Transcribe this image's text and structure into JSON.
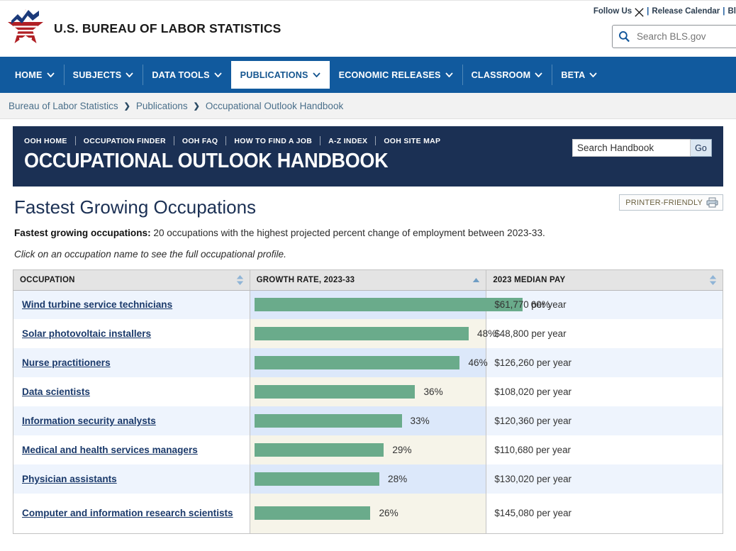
{
  "header": {
    "brand_name": "U.S. BUREAU OF LABOR STATISTICS",
    "follow_label": "Follow Us",
    "x_icon": "x-twitter-icon",
    "sep": "|",
    "release_calendar": "Release Calendar",
    "blog": "Bl",
    "search_placeholder": "Search BLS.gov",
    "search_value": "",
    "search_icon": "search-icon"
  },
  "mainnav": {
    "items": [
      {
        "label": "HOME",
        "active": false
      },
      {
        "label": "SUBJECTS",
        "active": false
      },
      {
        "label": "DATA TOOLS",
        "active": false
      },
      {
        "label": "PUBLICATIONS",
        "active": true
      },
      {
        "label": "ECONOMIC RELEASES",
        "active": false
      },
      {
        "label": "CLASSROOM",
        "active": false
      },
      {
        "label": "BETA",
        "active": false
      }
    ],
    "chevron_icon": "chevron-down-icon",
    "accent": "#115a9e",
    "active_text": "#14558f"
  },
  "breadcrumb": {
    "items": [
      "Bureau of Labor Statistics",
      "Publications",
      "Occupational Outlook Handbook"
    ],
    "separator_icon": "chevron-right-icon"
  },
  "ooh": {
    "subnav": [
      "OOH HOME",
      "OCCUPATION FINDER",
      "OOH FAQ",
      "HOW TO FIND A JOB",
      "A-Z INDEX",
      "OOH SITE MAP"
    ],
    "title": "OCCUPATIONAL OUTLOOK HANDBOOK",
    "banner_color": "#1b3054",
    "search_value": "Search Handbook",
    "search_placeholder": "Search Handbook",
    "go_label": "Go"
  },
  "page": {
    "title": "Fastest Growing Occupations",
    "printer_label": "PRINTER-FRIENDLY",
    "printer_icon": "printer-icon",
    "lead_bold": "Fastest growing occupations:",
    "lead_rest": " 20 occupations with the highest projected percent change of employment between 2023-33.",
    "note": "Click on an occupation name to see the full occupational profile."
  },
  "table": {
    "columns": [
      {
        "label": "OCCUPATION",
        "sort": "none",
        "sort_icon": "sort-both-icon"
      },
      {
        "label": "GROWTH RATE, 2023-33",
        "sort": "asc",
        "sort_icon": "sort-up-icon"
      },
      {
        "label": "2023 MEDIAN PAY",
        "sort": "none",
        "sort_icon": "sort-both-icon"
      }
    ],
    "bar_color": "#6aab8b",
    "rows": [
      {
        "occupation": "Wind turbine service technicians",
        "growth": 60,
        "growth_label": "60%",
        "pay": "$61,770 per year"
      },
      {
        "occupation": "Solar photovoltaic installers",
        "growth": 48,
        "growth_label": "48%",
        "pay": "$48,800 per year"
      },
      {
        "occupation": "Nurse practitioners",
        "growth": 46,
        "growth_label": "46%",
        "pay": "$126,260 per year"
      },
      {
        "occupation": "Data scientists",
        "growth": 36,
        "growth_label": "36%",
        "pay": "$108,020 per year"
      },
      {
        "occupation": "Information security analysts",
        "growth": 33,
        "growth_label": "33%",
        "pay": "$120,360 per year"
      },
      {
        "occupation": "Medical and health services managers",
        "growth": 29,
        "growth_label": "29%",
        "pay": "$110,680 per year"
      },
      {
        "occupation": "Physician assistants",
        "growth": 28,
        "growth_label": "28%",
        "pay": "$130,020 per year"
      },
      {
        "occupation": "Computer and information research scientists",
        "growth": 26,
        "growth_label": "26%",
        "pay": "$145,080 per year"
      }
    ]
  },
  "chart_data": {
    "type": "bar",
    "title": "Fastest Growing Occupations",
    "subtitle": "20 occupations with the highest projected percent change of employment between 2023-33.",
    "xlabel": "Growth rate, 2023-33 (percent)",
    "ylabel": "Occupation",
    "xlim": [
      0,
      60
    ],
    "grid": false,
    "orientation": "horizontal",
    "categories": [
      "Wind turbine service technicians",
      "Solar photovoltaic installers",
      "Nurse practitioners",
      "Data scientists",
      "Information security analysts",
      "Medical and health services managers",
      "Physician assistants",
      "Computer and information research scientists"
    ],
    "values": [
      60,
      48,
      46,
      36,
      33,
      29,
      28,
      26
    ],
    "value_labels": [
      "60%",
      "48%",
      "46%",
      "36%",
      "33%",
      "29%",
      "28%",
      "26%"
    ],
    "secondary_series": {
      "name": "2023 Median Pay (USD per year)",
      "values": [
        61770,
        48800,
        126260,
        108020,
        120360,
        110680,
        130020,
        145080
      ],
      "labels": [
        "$61,770 per year",
        "$48,800 per year",
        "$126,260 per year",
        "$108,020 per year",
        "$120,360 per year",
        "$110,680 per year",
        "$130,020 per year",
        "$145,080 per year"
      ]
    },
    "bar_color": "#6aab8b",
    "legend": []
  }
}
